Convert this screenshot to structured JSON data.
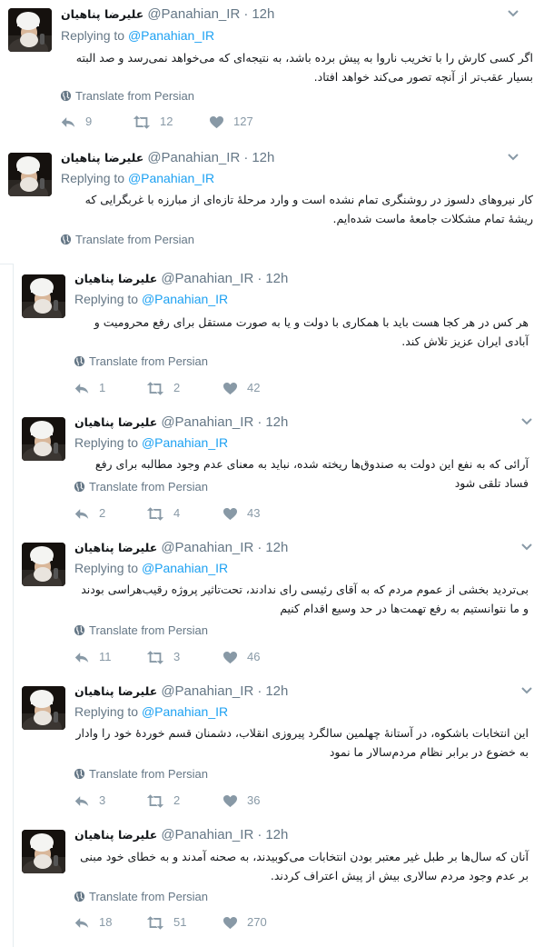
{
  "author": {
    "name": "علیرضا پناهیان",
    "handle": "@Panahian_IR",
    "dot": "·",
    "time": "12h"
  },
  "replying": {
    "prefix": "Replying to",
    "target": "@Panahian_IR"
  },
  "translate_label": "Translate from Persian",
  "icons": {
    "reply": "reply-icon",
    "retweet": "retweet-icon",
    "like": "heart-icon",
    "globe": "globe-icon",
    "caret": "chevron-down-icon"
  },
  "colors": {
    "link": "#1da1f2",
    "muted": "#657786",
    "action": "#8899a6",
    "border": "#e6ecf0"
  },
  "tweets": [
    {
      "text": "اگر کسی کارش را با تخریب ناروا به پیش برده باشد، به نتیجه‌ای که می‌خواهد نمی‌رسد و صد البته بسیار عقب‌تر از آنچه تصور می‌کند خواهد افتاد.",
      "replies": "9",
      "retweets": "12",
      "likes": "127"
    },
    {
      "text": "کار نیروهای دلسوز در روشنگری تمام نشده است و وارد مرحلهٔ تازه‌ای از مبارزه با غربگرایی که ریشهٔ تمام مشکلات جامعهٔ ماست شده‌ایم."
    },
    {
      "text": "هر کس در هر کجا هست باید با همکاری با دولت و یا به صورت مستقل برای رفع محرومیت و آبادی ایران عزیز تلاش کند.",
      "replies": "1",
      "retweets": "2",
      "likes": "42"
    },
    {
      "text": "آرائی که به نفع این دولت به صندوق‌ها ریخته شده، نباید به معنای عدم وجود مطالبه برای رفع فساد تلقی شود",
      "replies": "2",
      "retweets": "4",
      "likes": "43"
    },
    {
      "text": "بی‌تردید بخشی از عموم مردم که به آقای رئیسی رای ندادند، تحت‌تاثیر پروژه رقیب‌هراسی بودند و ما نتوانستیم به رفع تهمت‌ها در حد وسیع اقدام کنیم",
      "replies": "11",
      "retweets": "3",
      "likes": "46"
    },
    {
      "text": "این انتخابات باشکوه، در آستانهٔ چهلمین سالگرد پیروزی انقلاب، دشمنان قسم خوردهٔ خود را وادار به خضوع در برابر نظام مردم‌سالار ما نمود",
      "replies": "3",
      "retweets": "2",
      "likes": "36"
    },
    {
      "text": "آنان که سال‌ها بر طبل غیر معتبر بودن انتخابات می‌کوبیدند، به صحنه آمدند و به خطای خود مبنی بر عدم وجود مردم سالاری بیش از پیش اعتراف کردند.",
      "replies": "18",
      "retweets": "51",
      "likes": "270"
    }
  ]
}
